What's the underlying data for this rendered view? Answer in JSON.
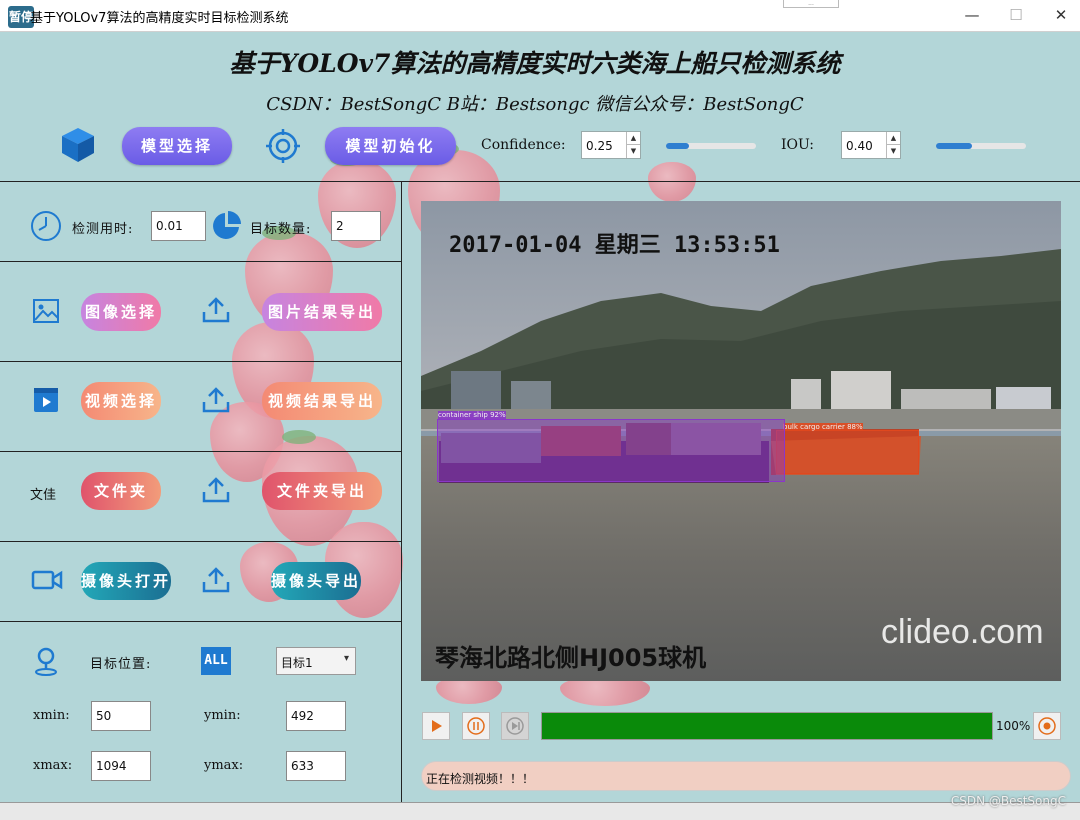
{
  "window": {
    "title": "基于YOLOv7算法的高精度实时目标检测系统",
    "icon_text": "暂停",
    "minimize": "—",
    "maximize": "☐",
    "close": "✕",
    "tooltip": "..."
  },
  "header": {
    "title": "基于YOLOv7算法的高精度实时六类海上船只检测系统",
    "subtitle": "CSDN：BestSongC   B站：Bestsongc   微信公众号：BestSongC"
  },
  "toolbar": {
    "model_select_label": "模型选择",
    "model_init_label": "模型初始化",
    "confidence_label": "Confidence:",
    "confidence_value": "0.25",
    "confidence_fraction": 0.25,
    "iou_label": "IOU:",
    "iou_value": "0.40",
    "iou_fraction": 0.4
  },
  "stats": {
    "time_label": "检测用时:",
    "time_value": "0.01",
    "count_label": "目标数量:",
    "count_value": "2"
  },
  "actions": {
    "image_select": "图像选择",
    "image_export": "图片结果导出",
    "video_select": "视频选择",
    "video_export": "视频结果导出",
    "folder_icon_text": "文佳",
    "folder": "文件夹",
    "folder_export": "文件夹导出",
    "camera_open": "摄像头打开",
    "camera_export": "摄像头导出"
  },
  "target": {
    "position_label": "目标位置:",
    "all_icon_text": "ALL",
    "selected_target": "目标1",
    "xmin_label": "xmin:",
    "xmin": "50",
    "ymin_label": "ymin:",
    "ymin": "492",
    "xmax_label": "xmax:",
    "xmax": "1094",
    "ymax_label": "ymax:",
    "ymax": "633"
  },
  "video": {
    "osd_datetime": "2017-01-04  星期三  13:53:51",
    "osd_location": "琴海北路北侧HJ005球机",
    "watermark": "clideo.com",
    "detections": [
      {
        "label": "container ship 92%",
        "color": "#8a37c9"
      },
      {
        "label": "bulk cargo carrier 88%",
        "color": "#e0481e"
      }
    ]
  },
  "playback": {
    "progress_percent": 100,
    "progress_text": "100%"
  },
  "status": {
    "text": "正在检测视频！！！"
  },
  "footer": {
    "credit": "CSDN @BestSongC"
  },
  "colors": {
    "background": "#b3d6d8",
    "accent_blue": "#1f7ad0",
    "progress_green": "#0a8a0a"
  }
}
